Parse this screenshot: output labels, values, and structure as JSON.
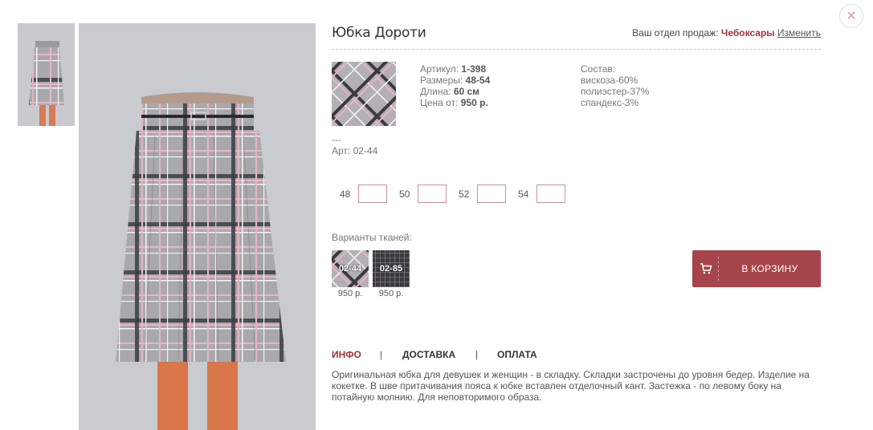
{
  "product": {
    "title": "Юбка Дороти",
    "specs": {
      "article_label": "Артикул:",
      "article": "1-398",
      "sizes_label": "Размеры:",
      "sizes": "48-54",
      "length_label": "Длина:",
      "length": "60 см",
      "price_label": "Цена от:",
      "price": "950 р."
    },
    "composition": {
      "label": "Состав:",
      "items": [
        "вискоза-60%",
        "полиэстер-37%",
        "спандекс-3%"
      ]
    },
    "dashes": "---",
    "art_code": "Арт: 02-44"
  },
  "sales_department": {
    "label": "Ваш отдел продаж:",
    "city": "Чебоксары",
    "change_link": "Изменить"
  },
  "size_inputs": [
    {
      "size": "48",
      "value": ""
    },
    {
      "size": "50",
      "value": ""
    },
    {
      "size": "52",
      "value": ""
    },
    {
      "size": "54",
      "value": ""
    }
  ],
  "variants": {
    "label": "Варианты тканей:",
    "items": [
      {
        "code": "02-44",
        "price": "950 р."
      },
      {
        "code": "02-85",
        "price": "950 р."
      }
    ]
  },
  "cart_button": {
    "label": "В КОРЗИНУ",
    "icon": "cart-icon"
  },
  "close_button": {
    "icon": "close-icon",
    "glyph": "✕"
  },
  "tabs": [
    {
      "label": "ИНФО",
      "active": true
    },
    {
      "label": "ДОСТАВКА",
      "active": false
    },
    {
      "label": "ОПЛАТА",
      "active": false
    }
  ],
  "tab_separator": "|",
  "description": "Оригинальная юбка для девушек и женщин - в складку. Складки застрочены до уровня бедер. Изделие на кокетке. В шве притачивания пояса к юбке вставлен отделочный кант. Застежка - по левому боку на потайную молнию. Для неповторимого образа.",
  "colors": {
    "accent": "#a0343c",
    "button": "#a5444a",
    "input_border": "#c9939a"
  }
}
